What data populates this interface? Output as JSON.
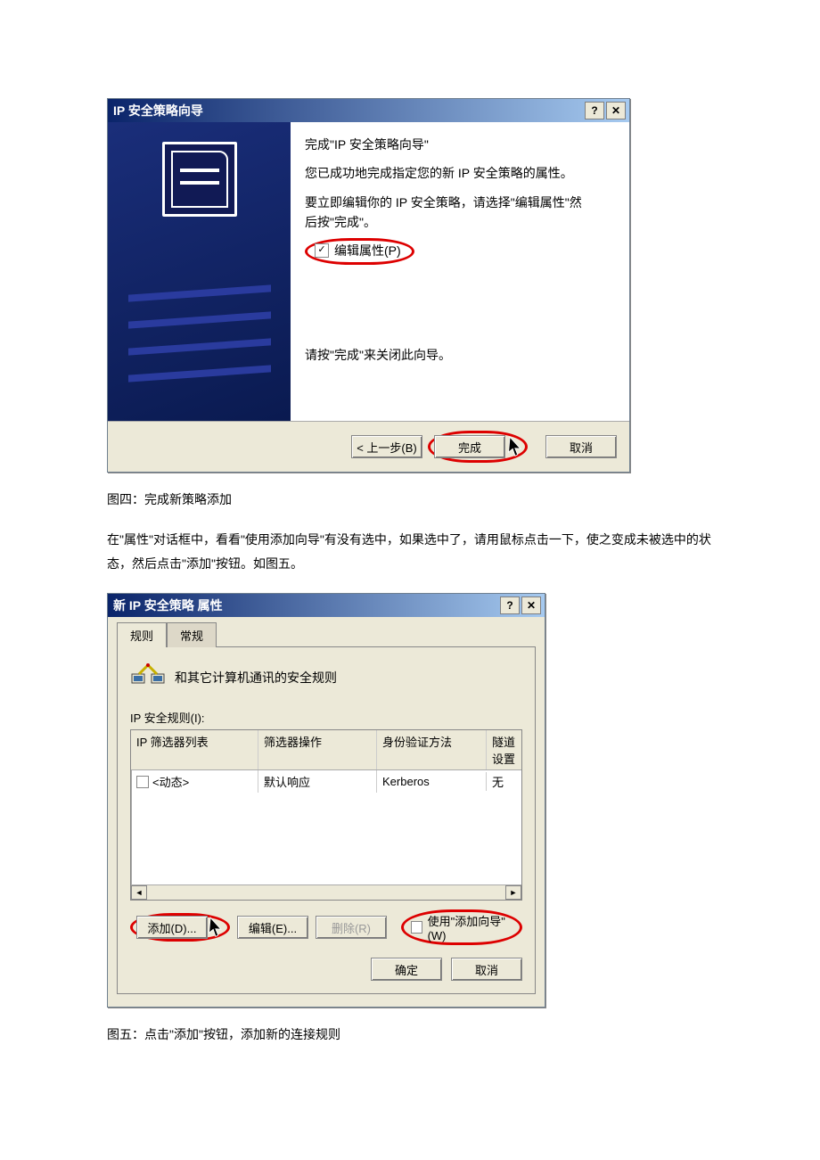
{
  "wizard": {
    "title": "IP 安全策略向导",
    "line1": "完成\"IP 安全策略向导\"",
    "line2": "您已成功地完成指定您的新 IP 安全策略的属性。",
    "line3a": "要立即编辑你的 IP 安全策略，请选择\"编辑属性\"然",
    "line3b": "后按\"完成\"。",
    "checkbox_label": "编辑属性(P)",
    "close_hint": "请按\"完成\"来关闭此向导。",
    "back_btn": "< 上一步(B)",
    "finish_btn": "完成",
    "cancel_btn": "取消"
  },
  "caption1": "图四：完成新策略添加",
  "paragraph": "在\"属性\"对话框中，看看\"使用添加向导\"有没有选中，如果选中了，请用鼠标点击一下，使之变成未被选中的状态，然后点击\"添加\"按钮。如图五。",
  "props": {
    "title": "新 IP 安全策略 属性",
    "tab_rules": "规则",
    "tab_general": "常规",
    "header_text": "和其它计算机通讯的安全规则",
    "list_label": "IP 安全规则(I):",
    "cols": {
      "c1": "IP 筛选器列表",
      "c2": "筛选器操作",
      "c3": "身份验证方法",
      "c4": "隧道设置"
    },
    "row": {
      "c1": "<动态>",
      "c2": "默认响应",
      "c3": "Kerberos",
      "c4": "无"
    },
    "add_btn": "添加(D)...",
    "edit_btn": "编辑(E)...",
    "delete_btn": "删除(R)",
    "use_wizard": "使用\"添加向导\"(W)",
    "ok_btn": "确定",
    "cancel_btn": "取消"
  },
  "caption2": "图五：点击\"添加\"按钮，添加新的连接规则"
}
